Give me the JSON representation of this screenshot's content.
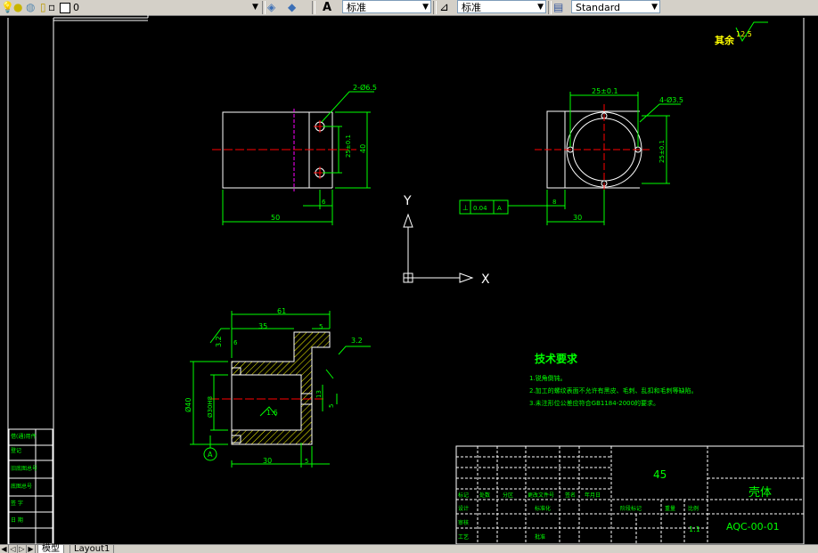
{
  "toolbar": {
    "layer_name": "0",
    "text_style": "标准",
    "dim_style": "标准",
    "table_style": "Standard"
  },
  "tabs": {
    "model": "模型",
    "layout1": "Layout1"
  },
  "drawing": {
    "surface_finish_other": "其余",
    "roughness_other": "12.5",
    "top_left": {
      "hole_note": "2-Ø6.5",
      "width_dim": "50",
      "height_dim": "40",
      "tol_dim": "25±0.1",
      "small_dim": "6"
    },
    "top_right": {
      "top_dim": "25±0.1",
      "hole_note": "4-Ø3.5",
      "side_dim": "25±0.1",
      "bottom_dim": "30",
      "offset_dim": "8",
      "tolerance_box": [
        "⊥",
        "0.04",
        "A"
      ]
    },
    "section": {
      "top_dim": "61",
      "left_dim": "35",
      "flange_dim": "5",
      "roughness_right": "3.2",
      "roughness_left": "3.2",
      "step_dim": "6",
      "bore_outer": "Ø40",
      "bore_inner": "Ø30H8",
      "roughness_bore": "1.6",
      "slot_dim": "5",
      "side_tol": "13",
      "bottom_dim": "30",
      "bottom_right": "5",
      "datum": "A"
    },
    "ucs": {
      "x": "X",
      "y": "Y"
    },
    "tech": {
      "title": "技术要求",
      "items": [
        "1.锐角倒钝。",
        "2.加工的螺纹表面不允许有黑皮、毛刺、乱扣和毛刺等缺陷。",
        "3.未注形位公差应符合GB1184-2000的要求。"
      ]
    },
    "title_block": {
      "material": "45",
      "part_name": "壳体",
      "drawing_no": "AQC-00-01",
      "scale": "1:1",
      "labels": [
        "标记",
        "处数",
        "分区",
        "更改文件号",
        "签名",
        "年月日"
      ],
      "row2": [
        "设计",
        "标准化",
        "阶段标记",
        "重量",
        "比例"
      ],
      "row3": [
        "审核"
      ],
      "row4": [
        "工艺",
        "批准"
      ]
    },
    "left_block": [
      "借(通)用件",
      "登记",
      "旧底图总号",
      "底图总号",
      "签 字",
      "日 期"
    ]
  }
}
